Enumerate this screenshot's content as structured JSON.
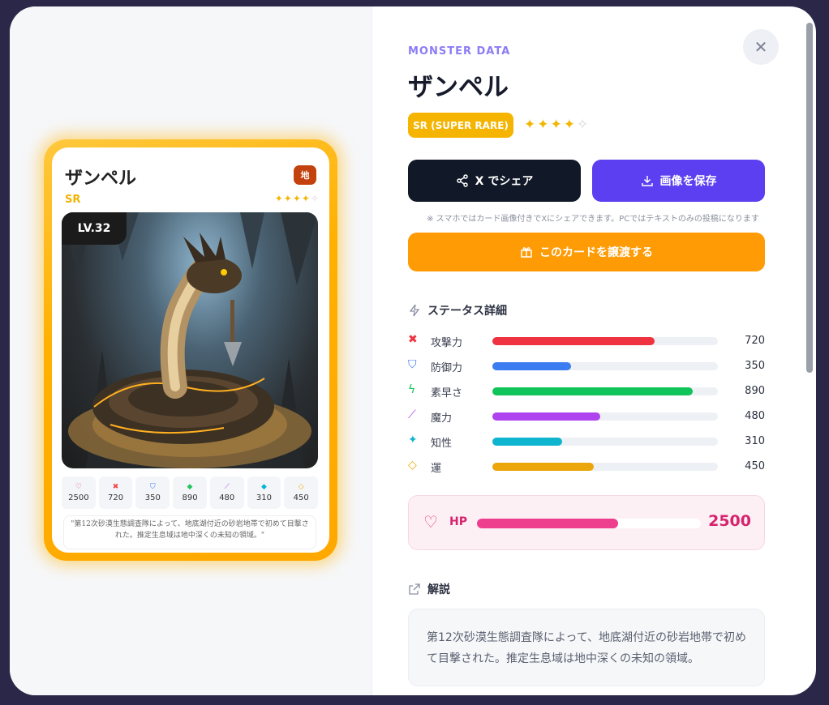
{
  "card": {
    "name": "ザンペル",
    "element": "地",
    "rarity": "SR",
    "stars_filled": "✦✦✦✦",
    "stars_empty": "✧",
    "level": "LV.32",
    "stats": [
      {
        "icon": "heart-icon",
        "symbol": "♡",
        "value": "2500",
        "color": "#e23d7c"
      },
      {
        "icon": "sword-icon",
        "symbol": "✖",
        "value": "720",
        "color": "#ef4444"
      },
      {
        "icon": "shield-icon",
        "symbol": "⛉",
        "value": "350",
        "color": "#3b82f6"
      },
      {
        "icon": "bolt-icon",
        "symbol": "◆",
        "value": "890",
        "color": "#22c55e"
      },
      {
        "icon": "wand-icon",
        "symbol": "⟋",
        "value": "480",
        "color": "#a855f7"
      },
      {
        "icon": "sparkle-icon",
        "symbol": "◆",
        "value": "310",
        "color": "#06b6d4"
      },
      {
        "icon": "diamond-icon",
        "symbol": "◇",
        "value": "450",
        "color": "#eab308"
      }
    ],
    "description": "\"第12次砂漠生態調査隊によって、地底湖付近の砂岩地帯で初めて目撃された。推定生息域は地中深くの未知の領域。\""
  },
  "detail": {
    "eyebrow": "MONSTER DATA",
    "title": "ザンペル",
    "rarity_label": "SR (SUPER RARE)",
    "stars_filled": "✦✦✦✦",
    "stars_empty": "✧",
    "close_symbol": "✕",
    "share_label": "X でシェア",
    "save_label": "画像を保存",
    "note": "※ スマホではカード画像付きでXにシェアできます。PCではテキストのみの投稿になります",
    "transfer_label": "このカードを譲渡する",
    "status_heading": "ステータス詳細",
    "stats": [
      {
        "name": "攻撃力",
        "value": "720",
        "ratio": 0.72,
        "color": "#ef3340",
        "icon": "sword-icon",
        "symbol": "✖"
      },
      {
        "name": "防御力",
        "value": "350",
        "ratio": 0.35,
        "color": "#3b7cf0",
        "icon": "shield-icon",
        "symbol": "⛉"
      },
      {
        "name": "素早さ",
        "value": "890",
        "ratio": 0.89,
        "color": "#10c45a",
        "icon": "bolt-icon",
        "symbol": "ϟ"
      },
      {
        "name": "魔力",
        "value": "480",
        "ratio": 0.48,
        "color": "#ad44ef",
        "icon": "wand-icon",
        "symbol": "⟋"
      },
      {
        "name": "知性",
        "value": "310",
        "ratio": 0.31,
        "color": "#0fb5cf",
        "icon": "sparkle-icon",
        "symbol": "✦"
      },
      {
        "name": "運",
        "value": "450",
        "ratio": 0.45,
        "color": "#eaa60a",
        "icon": "diamond-icon",
        "symbol": "◇"
      }
    ],
    "hp_label": "HP",
    "hp_value": "2500",
    "hp_ratio": 0.63,
    "desc_heading": "解説",
    "description": "第12次砂漠生態調査隊によって、地底湖付近の砂岩地帯で初めて目撃された。推定生息域は地中深くの未知の領域。"
  }
}
